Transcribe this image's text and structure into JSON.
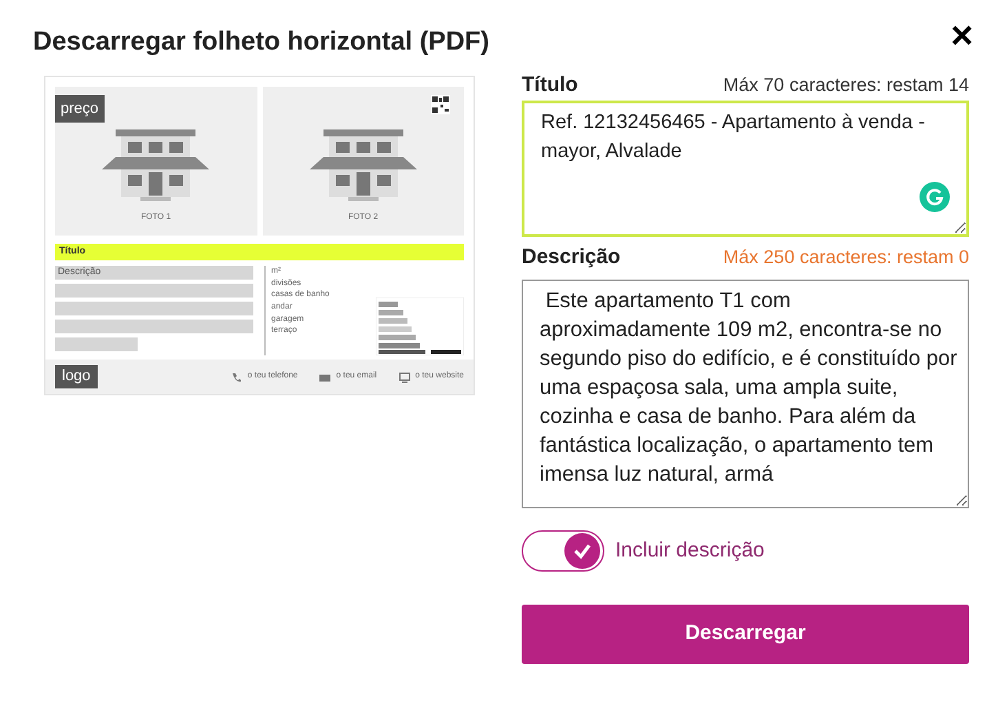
{
  "dialog": {
    "title": "Descarregar folheto horizontal (PDF)",
    "close": "×"
  },
  "preview": {
    "price": "preço",
    "photos": [
      "FOTO 1",
      "FOTO 2"
    ],
    "title": "Título",
    "description": "Descrição",
    "features": [
      "m²",
      "divisões",
      "casas de banho",
      "andar",
      "garagem",
      "terraço"
    ],
    "logo": "logo",
    "contacts": [
      {
        "kind": "phone",
        "text": "o teu telefone"
      },
      {
        "kind": "email",
        "text": "o teu email"
      },
      {
        "kind": "web",
        "text": "o teu website"
      }
    ]
  },
  "title_field": {
    "label": "Título",
    "limit": "Máx 70 caracteres: restam 14",
    "limit_reached": false,
    "value": "Ref. 12132456465 - Apartamento à venda - mayor, Alvalade"
  },
  "description_field": {
    "label": "Descrição",
    "limit": "Máx 250 caracteres: restam 0",
    "limit_reached": true,
    "value": " Este apartamento T1 com aproximadamente 109 m2, encontra-se no segundo piso do edifício, e é constituído por uma espaçosa sala, uma ampla suite, cozinha e casa de banho. Para além da fantástica localização, o apartamento tem imensa luz natural, armá"
  },
  "include_description": {
    "label": "Incluir descrição",
    "on": true
  },
  "download_button": "Descarregar"
}
